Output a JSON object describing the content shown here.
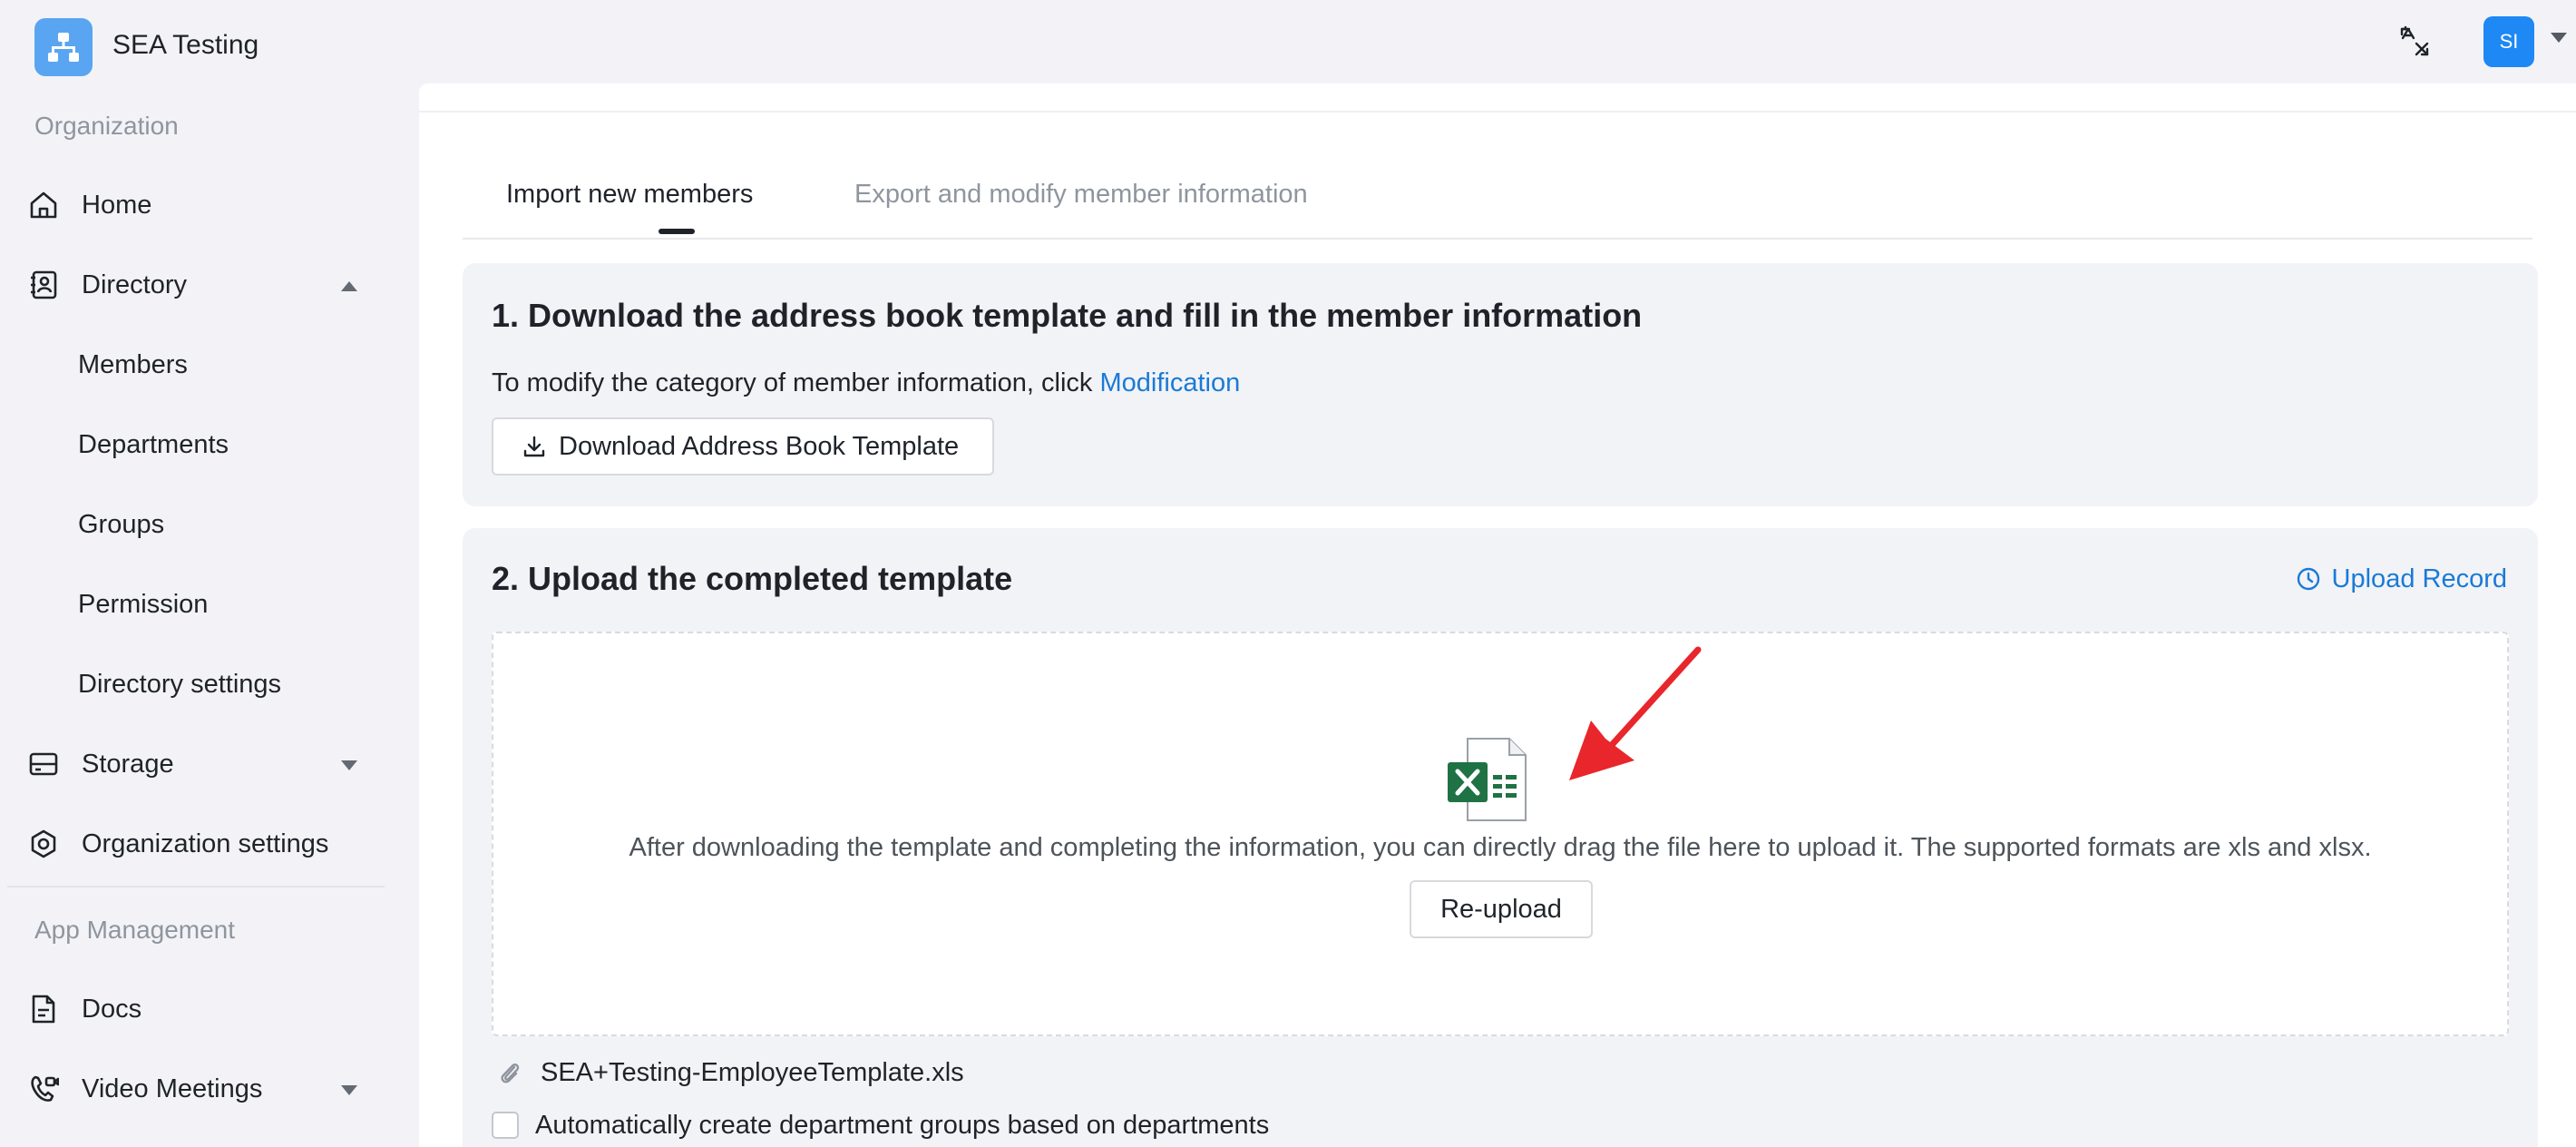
{
  "header": {
    "app_name": "SEA Testing",
    "avatar_initials": "SI"
  },
  "sidebar": {
    "organization_label": "Organization",
    "items": [
      {
        "label": "Home",
        "icon": "home-icon"
      },
      {
        "label": "Directory",
        "icon": "directory-icon",
        "expanded": true
      },
      {
        "label": "Members"
      },
      {
        "label": "Departments"
      },
      {
        "label": "Groups"
      },
      {
        "label": "Permission"
      },
      {
        "label": "Directory settings"
      },
      {
        "label": "Storage",
        "icon": "storage-icon",
        "expanded": false
      },
      {
        "label": "Organization settings",
        "icon": "organization-settings-icon"
      }
    ],
    "app_management_label": "App Management",
    "app_items": [
      {
        "label": "Docs",
        "icon": "docs-icon"
      },
      {
        "label": "Video Meetings",
        "icon": "video-meetings-icon",
        "expanded": false
      }
    ]
  },
  "tabs": [
    {
      "label": "Import new members",
      "active": true
    },
    {
      "label": "Export and modify member information",
      "active": false
    }
  ],
  "step1": {
    "title": "1. Download the address book template and fill in the member information",
    "hint_prefix": "To modify the category of member information, click ",
    "hint_link": "Modification",
    "download_button": "Download Address Book Template"
  },
  "step2": {
    "title": "2. Upload the completed template",
    "upload_record": "Upload Record",
    "drop_hint": "After downloading the template and completing the information, you can directly drag the file here to upload it. The supported formats are xls and xlsx.",
    "reupload_button": "Re-upload",
    "file_name": "SEA+Testing-EmployeeTemplate.xls",
    "checkbox_label": "Automatically create department groups based on departments",
    "checkbox_checked": false
  },
  "colors": {
    "accent": "#1a7ad6",
    "logo": "#5aa5f2",
    "avatar": "#1e88f5",
    "excel_green": "#1f7244",
    "annotation_arrow": "#e8262b"
  }
}
